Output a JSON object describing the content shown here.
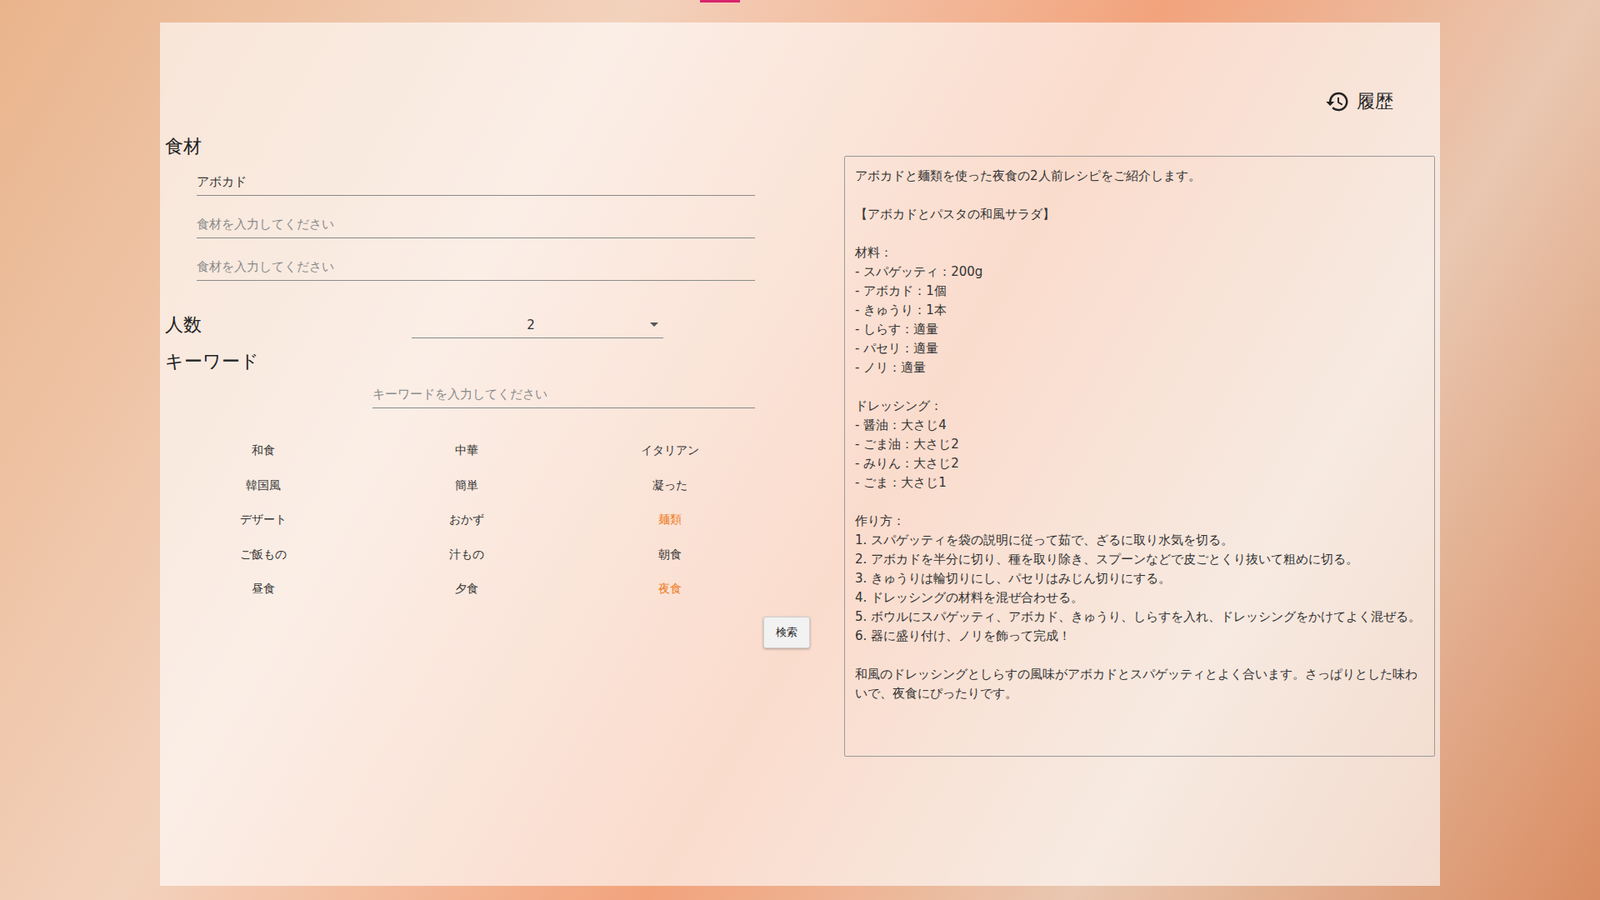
{
  "ingredients": {
    "label": "食材",
    "fields": [
      {
        "text": "アボカド",
        "kind": "value"
      },
      {
        "text": "食材を入力してください",
        "kind": "placeholder"
      },
      {
        "text": "食材を入力してください",
        "kind": "placeholder"
      }
    ]
  },
  "servings": {
    "label": "人数",
    "value": "2"
  },
  "keyword": {
    "label": "キーワード",
    "placeholder": "キーワードを入力してください"
  },
  "tags": [
    {
      "label": "和食",
      "selected": false
    },
    {
      "label": "中華",
      "selected": false
    },
    {
      "label": "イタリアン",
      "selected": false
    },
    {
      "label": "韓国風",
      "selected": false
    },
    {
      "label": "簡単",
      "selected": false
    },
    {
      "label": "凝った",
      "selected": false
    },
    {
      "label": "デザート",
      "selected": false
    },
    {
      "label": "おかず",
      "selected": false
    },
    {
      "label": "麺類",
      "selected": true
    },
    {
      "label": "ご飯もの",
      "selected": false
    },
    {
      "label": "汁もの",
      "selected": false
    },
    {
      "label": "朝食",
      "selected": false
    },
    {
      "label": "昼食",
      "selected": false
    },
    {
      "label": "夕食",
      "selected": false
    },
    {
      "label": "夜食",
      "selected": true
    }
  ],
  "search_button": "検索",
  "history_button": "履歴",
  "result": {
    "text": "アボカドと麺類を使った夜食の2人前レシピをご紹介します。\n\n【アボカドとパスタの和風サラダ】\n\n材料：\n- スパゲッティ：200g\n- アボカド：1個\n- きゅうり：1本\n- しらす：適量\n- パセリ：適量\n- ノリ：適量\n\nドレッシング：\n- 醤油：大さじ4\n- ごま油：大さじ2\n- みりん：大さじ2\n- ごま：大さじ1\n\n作り方：\n1. スパゲッティを袋の説明に従って茹で、ざるに取り水気を切る。\n2. アボカドを半分に切り、種を取り除き、スプーンなどで皮ごとくり抜いて粗めに切る。\n3. きゅうりは輪切りにし、パセリはみじん切りにする。\n4. ドレッシングの材料を混ぜ合わせる。\n5. ボウルにスパゲッティ、アボカド、きゅうり、しらすを入れ、ドレッシングをかけてよく混ぜる。\n6. 器に盛り付け、ノリを飾って完成！\n\n和風のドレッシングとしらすの風味がアボカドとスパゲッティとよく合います。さっぱりとした味わいで、夜食にぴったりです。"
  }
}
